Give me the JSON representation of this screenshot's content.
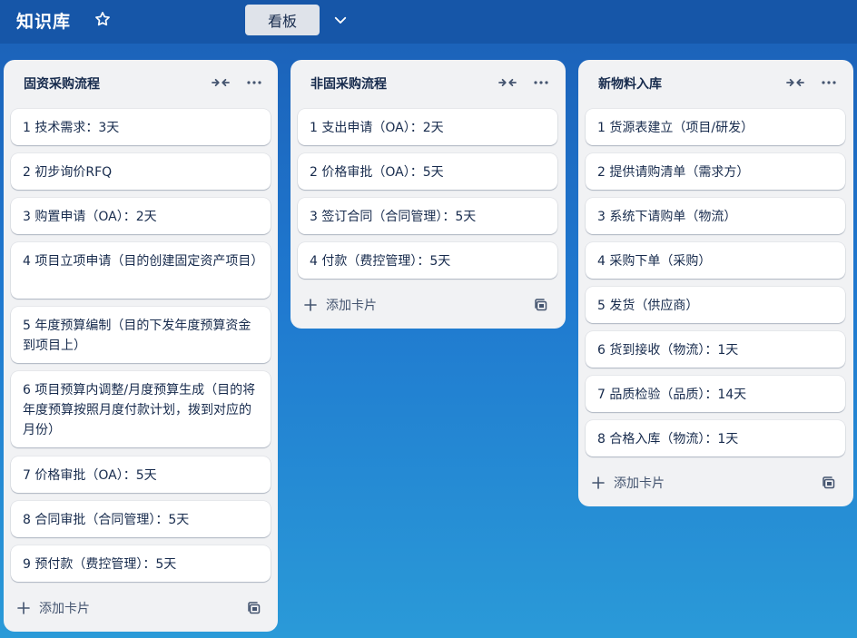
{
  "header": {
    "board_title": "知识库",
    "view_label": "看板"
  },
  "lists": [
    {
      "title": "固资采购流程",
      "cards": [
        "1 技术需求：3天",
        "2 初步询价RFQ",
        "3 购置申请（OA）：2天",
        "4 项目立项申请（目的创建固定资产项目）",
        "5 年度预算编制（目的下发年度预算资金到项目上）",
        "6 项目预算内调整/月度预算生成（目的将年度预算按照月度付款计划，拨到对应的月份）",
        "7 价格审批（OA）：5天",
        "8 合同审批（合同管理）：5天",
        "9 预付款（费控管理）：5天"
      ],
      "add_card_label": "添加卡片"
    },
    {
      "title": "非固采购流程",
      "cards": [
        "1 支出申请（OA）：2天",
        "2 价格审批（OA）：5天",
        "3 签订合同（合同管理）：5天",
        "4 付款（费控管理）：5天"
      ],
      "add_card_label": "添加卡片"
    },
    {
      "title": "新物料入库",
      "cards": [
        "1 货源表建立（项目/研发）",
        "2 提供请购清单（需求方）",
        "3 系统下请购单（物流）",
        "4 采购下单（采购）",
        "5 发货（供应商）",
        "6 货到接收（物流）：1天",
        "7 品质检验（品质）：14天",
        "8 合格入库（物流）：1天"
      ],
      "add_card_label": "添加卡片"
    }
  ],
  "icons": {
    "star": "star-icon",
    "view_toggle": "chevron-down-icon",
    "collapse": "collapse-arrows-icon",
    "more": "more-dots-icon",
    "add": "plus-icon",
    "template": "template-icon"
  },
  "colors": {
    "header_bg": "#1656a8",
    "list_bg": "#f1f2f4",
    "card_bg": "#ffffff",
    "text": "#172b4d"
  }
}
